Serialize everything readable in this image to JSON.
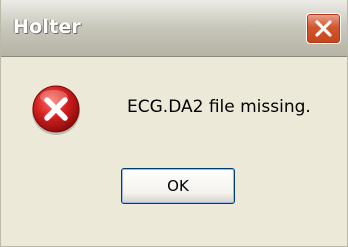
{
  "window": {
    "title": "Holter",
    "close_icon": "close-icon"
  },
  "dialog": {
    "icon": "error-icon",
    "message": "ECG.DA2 file missing.",
    "ok_label": "OK"
  },
  "colors": {
    "dialog_background": "#ece9d8",
    "close_button": "#d2562d",
    "error_icon": "#d11e1e"
  }
}
